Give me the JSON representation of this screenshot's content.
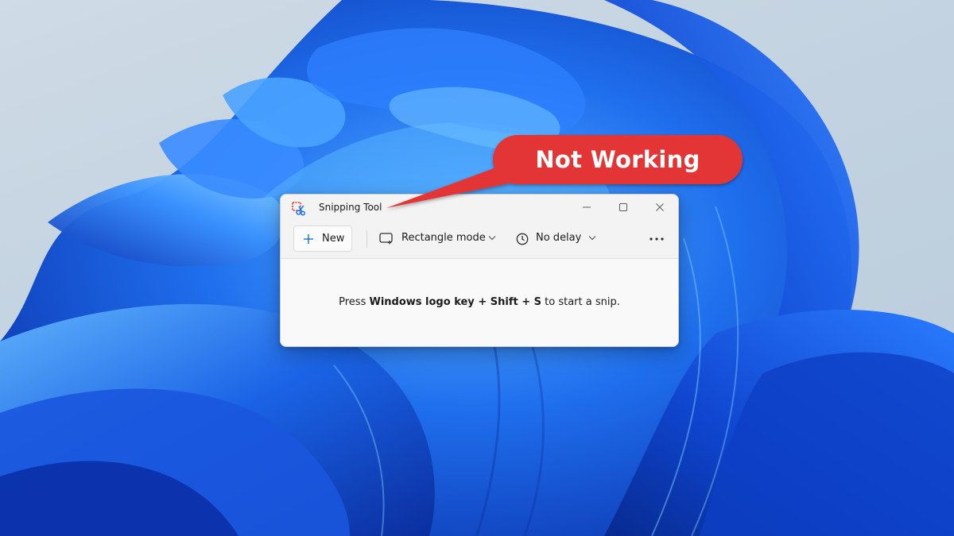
{
  "window": {
    "title": "Snipping Tool",
    "icon": "snipping-tool-scissors-icon",
    "controls": [
      "minimize-icon",
      "maximize-icon",
      "close-icon"
    ]
  },
  "toolbar": {
    "new_label": "New",
    "new_icon": "plus-icon",
    "mode_label": "Rectangle mode",
    "mode_icon": "rectangle-mode-icon",
    "delay_label": "No delay",
    "delay_icon": "clock-icon",
    "more_icon": "more-options-icon"
  },
  "hint": {
    "prefix": "Press ",
    "shortcut_windows": "Windows logo key",
    "plus1": " + ",
    "shortcut_shift": "Shift",
    "plus2": " + ",
    "shortcut_s": "S",
    "suffix": " to start a snip."
  },
  "callout": {
    "text": "Not Working",
    "color": "#e33535"
  },
  "colors": {
    "accent": "#0067c0",
    "wallpaper_blue": "#1f5fe8"
  }
}
